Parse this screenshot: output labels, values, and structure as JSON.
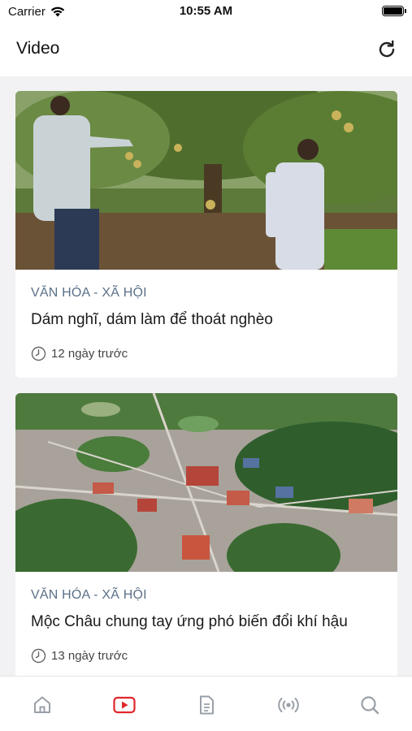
{
  "status": {
    "carrier": "Carrier",
    "time": "10:55 AM"
  },
  "header": {
    "title": "Video"
  },
  "videos": [
    {
      "category": "VĂN HÓA - XÃ HỘI",
      "title": "Dám nghĩ, dám làm để thoát nghèo",
      "age": "12 ngày trước"
    },
    {
      "category": "VĂN HÓA - XÃ HỘI",
      "title": "Mộc Châu chung tay ứng phó biến đổi khí hậu",
      "age": "13 ngày trước"
    }
  ],
  "tabs": [
    {
      "name": "home",
      "active": false
    },
    {
      "name": "video",
      "active": true
    },
    {
      "name": "news",
      "active": false
    },
    {
      "name": "radio",
      "active": false
    },
    {
      "name": "search",
      "active": false
    }
  ],
  "colors": {
    "accent": "#e0262b",
    "category": "#5b7088",
    "tab_inactive": "#9aa0a8"
  }
}
